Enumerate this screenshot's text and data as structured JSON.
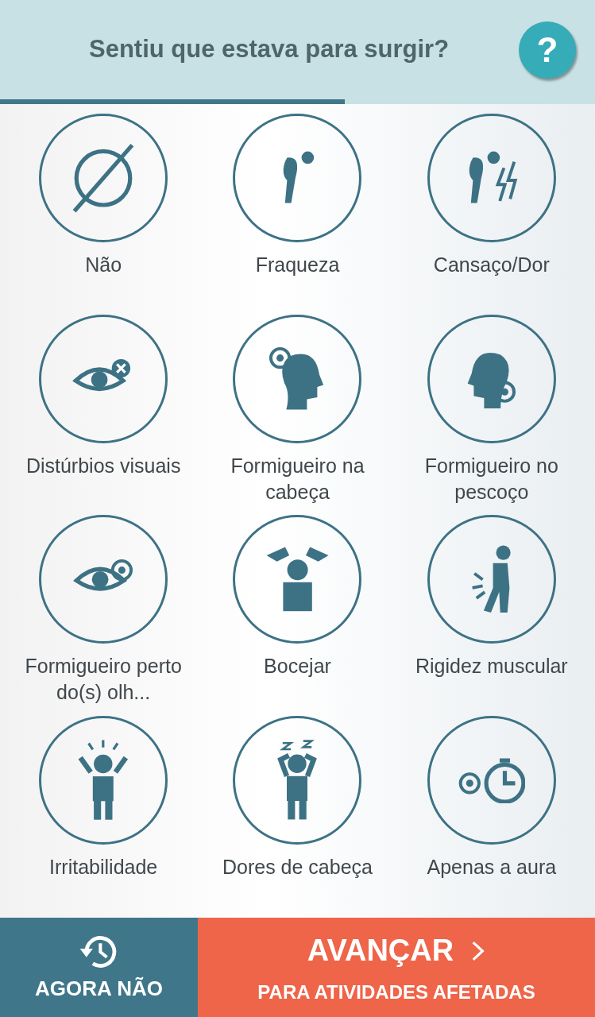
{
  "header": {
    "title": "Sentiu que estava para surgir?",
    "help": "?"
  },
  "progress": {
    "level": 0.58
  },
  "options": [
    {
      "label": "Não"
    },
    {
      "label": "Fraqueza"
    },
    {
      "label": "Cansaço/Dor"
    },
    {
      "label": "Distúrbios visuais"
    },
    {
      "label": "Formigueiro na cabeça"
    },
    {
      "label": "Formigueiro no pescoço"
    },
    {
      "label": "Formigueiro perto do(s) olh..."
    },
    {
      "label": "Bocejar"
    },
    {
      "label": "Rigidez muscular"
    },
    {
      "label": "Irritabilidade"
    },
    {
      "label": "Dores de cabeça"
    },
    {
      "label": "Apenas a aura"
    }
  ],
  "footer": {
    "skip": "AGORA NÃO",
    "next": "AVANÇAR",
    "next_sub": "PARA ATIVIDADES AFETADAS"
  }
}
